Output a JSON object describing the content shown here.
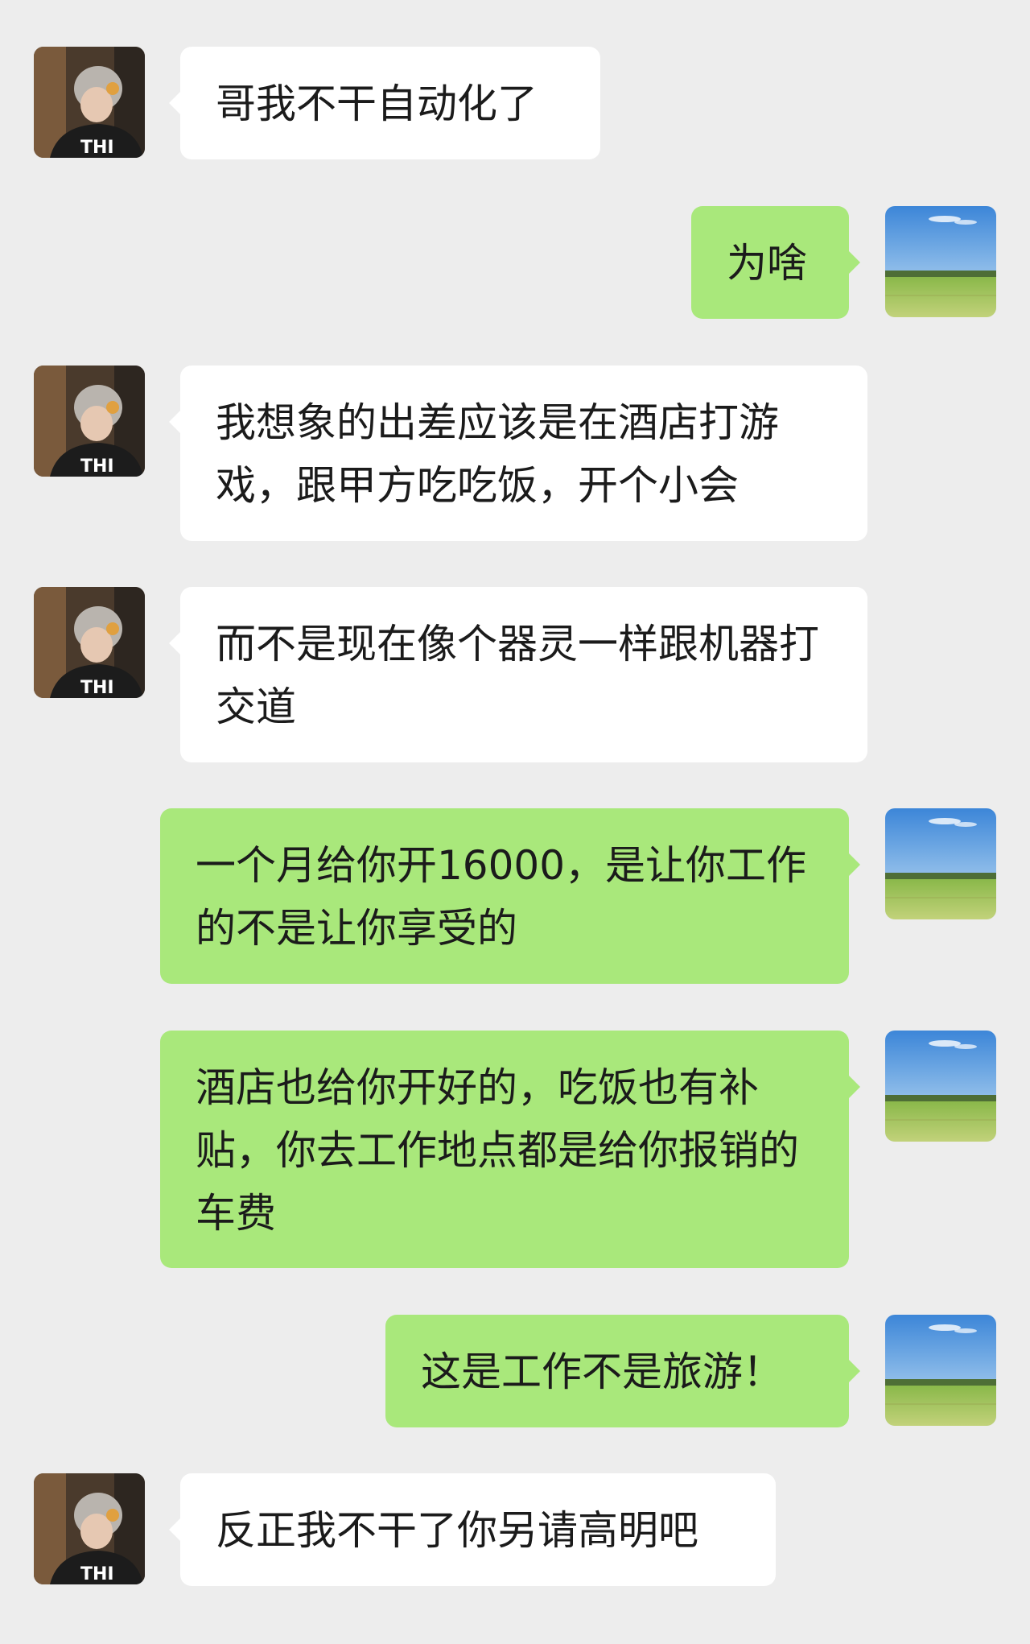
{
  "colors": {
    "background": "#ededed",
    "incoming_bubble": "#ffffff",
    "outgoing_bubble": "#a9e87b",
    "text": "#1b1b1b"
  },
  "avatars": {
    "contact_icon": "contact-avatar-person-icon",
    "self_icon": "self-avatar-landscape-icon"
  },
  "messages": [
    {
      "side": "in",
      "text": "哥我不干自动化了"
    },
    {
      "side": "out",
      "text": "为啥"
    },
    {
      "side": "in",
      "text": "我想象的出差应该是在酒店打游戏，跟甲方吃吃饭，开个小会"
    },
    {
      "side": "in",
      "text": "而不是现在像个器灵一样跟机器打交道"
    },
    {
      "side": "out",
      "text": "一个月给你开16000，是让你工作的不是让你享受的"
    },
    {
      "side": "out",
      "text": "酒店也给你开好的，吃饭也有补贴，你去工作地点都是给你报销的车费"
    },
    {
      "side": "out",
      "text": "这是工作不是旅游！"
    },
    {
      "side": "in",
      "text": "反正我不干了你另请高明吧"
    }
  ]
}
